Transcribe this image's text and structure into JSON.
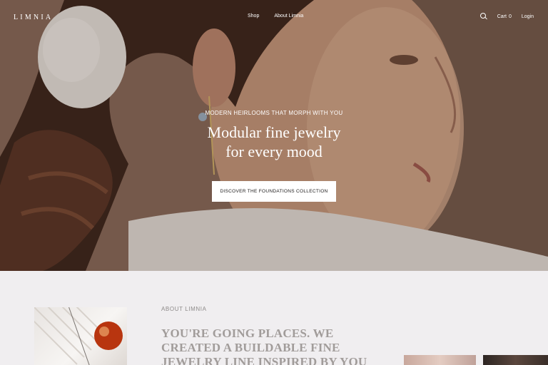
{
  "nav": {
    "logo": "LIMNIA",
    "links": [
      "Shop",
      "About Limnia"
    ],
    "search_icon": "search-icon",
    "cart_label": "Cart",
    "cart_count": "0",
    "login_label": "Login"
  },
  "hero": {
    "eyebrow": "MODERN HEIRLOOMS THAT MORPH WITH YOU",
    "headline_line1": "Modular fine jewelry",
    "headline_line2": "for every mood",
    "cta_label": "DISCOVER THE FOUNDATIONS COLLECTION"
  },
  "about": {
    "label": "ABOUT LIMNIA",
    "heading": "YOU'RE GOING PLACES. WE CREATED A BUILDABLE FINE JEWELRY LINE INSPIRED BY YOU"
  },
  "colors": {
    "hero_text": "#ffffff",
    "section_bg": "#f0eef0",
    "heading_text": "#a19c9a"
  }
}
